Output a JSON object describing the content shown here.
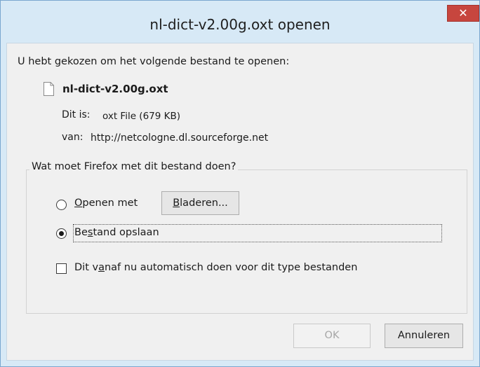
{
  "window": {
    "title": "nl-dict-v2.00g.oxt openen",
    "close_glyph": "✕"
  },
  "intro": "U hebt gekozen om het volgende bestand te openen:",
  "file": {
    "name": "nl-dict-v2.00g.oxt",
    "icon": "document-icon",
    "type_label": "Dit is:",
    "type_value": "oxt File (679 KB)",
    "source_label": "van:",
    "source_value": "http://netcologne.dl.sourceforge.net"
  },
  "action_group": {
    "legend": "Wat moet Firefox met dit bestand doen?",
    "open_with": {
      "label_prefix": "",
      "label_mnemonic": "O",
      "label_rest": "penen met",
      "selected": false
    },
    "browse_button": {
      "label_mnemonic": "B",
      "label_rest": "laderen..."
    },
    "save_file": {
      "label_prefix": "Be",
      "label_mnemonic": "s",
      "label_rest": "tand opslaan",
      "selected": true
    },
    "auto_checkbox": {
      "label_prefix": "Dit v",
      "label_mnemonic": "a",
      "label_rest": "naf nu automatisch doen voor dit type bestanden",
      "checked": false
    }
  },
  "buttons": {
    "ok": "OK",
    "cancel": "Annuleren"
  },
  "colors": {
    "title_bar": "#d7e9f6",
    "close_button": "#c7463e",
    "client": "#f0f0f0"
  }
}
